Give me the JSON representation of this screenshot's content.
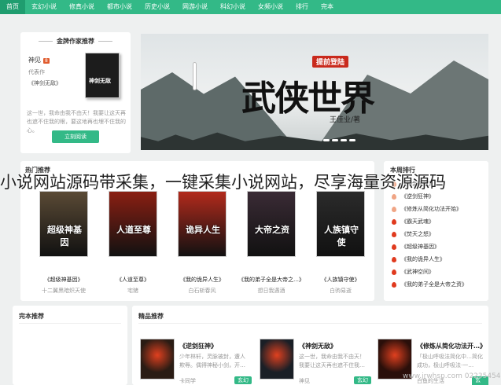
{
  "nav": {
    "items": [
      "首页",
      "玄幻小说",
      "修真小说",
      "都市小说",
      "历史小说",
      "网游小说",
      "科幻小说",
      "女频小说",
      "排行",
      "完本"
    ],
    "active_index": 0,
    "accent": "#33b987",
    "active_bg": "#1f9d6f"
  },
  "author_card": {
    "title": "金牌作家推荐",
    "author": "神见",
    "badge": "8",
    "rep_label": "代表作",
    "work": "《神剑无敌》",
    "description": "这一世，我命由我不由天！我要让这天再也遮不住我的眼，要这地再也埋不住我的心。",
    "read_button": "立刻阅读",
    "cover_text": "神剑无敌"
  },
  "banner": {
    "title": "武侠世界",
    "badge": "提前登陆",
    "author": "王佳业/著"
  },
  "caption": "小说网站源码带采集，一键采集小说网站，尽享海量资源源码",
  "hot": {
    "title": "热门推荐",
    "books": [
      {
        "name": "《超级神基因》",
        "author": "十二翼黑暗炽天使",
        "overlay": "超级神基因",
        "color": "#5a4a35"
      },
      {
        "name": "《人道至尊》",
        "author": "宅猪",
        "overlay": "人道至尊",
        "color": "#8a1f12"
      },
      {
        "name": "《我的诡异人生》",
        "author": "白石斩春风",
        "overlay": "诡异人生",
        "color": "#b22a1c"
      },
      {
        "name": "《我的弟子全是大帝之…》",
        "author": "想日我遇酒",
        "overlay": "大帝之资",
        "color": "#3a2b35"
      },
      {
        "name": "《人族镇守使》",
        "author": "白驹易逝",
        "overlay": "人族镇守使",
        "color": "#2b2b2b"
      }
    ]
  },
  "rank": {
    "title": "本周排行",
    "items": [
      "《神剑无敌》",
      "《逆剑狂神》",
      "《修炼从简化功法开始》",
      "《霸天武魂》",
      "《焚天之怒》",
      "《超级神基因》",
      "《我的诡异人生》",
      "《武神空间》",
      "《我的弟子全是大帝之资》"
    ]
  },
  "wanben": {
    "title": "完本推荐"
  },
  "jingpin": {
    "title": "精品推荐",
    "books": [
      {
        "name": "《逆剑狂神》",
        "desc": "少年林轩，灵脉被封，遭人欺辱。偶得神秘小剑，开…",
        "author": "卡同学",
        "tag": "玄幻",
        "color": "#2a1c14",
        "cover_text": "逆剑狂神"
      },
      {
        "name": "《神剑无敌》",
        "desc": "这一世，我命由我不由天！我要让这天再也遮不住我…",
        "author": "神见",
        "tag": "玄幻",
        "color": "#1a1f26",
        "cover_text": "神剑无敌"
      },
      {
        "name": "《修炼从简化功法开…》",
        "desc": "「极山呼吸法简化中…简化成功，极山呼吸法·一…",
        "author": "白鱼的生活",
        "tag": "玄幻",
        "color": "#2a0f0a",
        "cover_text": ""
      }
    ]
  },
  "watermark": "www.jrwhsp.com 02235454"
}
